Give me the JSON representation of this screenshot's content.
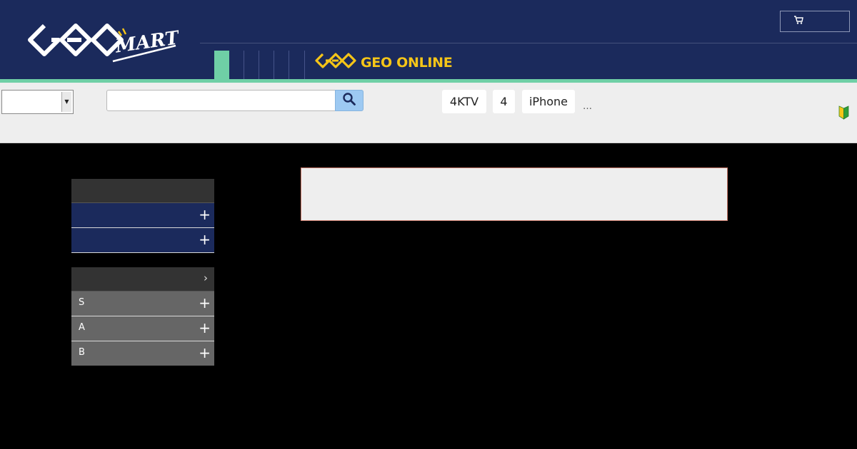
{
  "header": {
    "logo": {
      "text": "GEO MART",
      "icon": "geo-mart-logo"
    },
    "cart": {
      "label": "",
      "icon": "cart-icon"
    },
    "nav_tabs": [
      "",
      "",
      "",
      "",
      "",
      ""
    ],
    "geo_online": {
      "label": "GEO ONLINE",
      "icon": "geo-logo"
    }
  },
  "search": {
    "category_select": {
      "value": ""
    },
    "input": {
      "value": "",
      "placeholder": ""
    },
    "button_icon": "search-icon",
    "keywords": [
      "4KTV",
      "4",
      "iPhone"
    ],
    "more": "…",
    "beginner_icon": "beginner-mark-icon"
  },
  "sidebar": {
    "header": "",
    "rows": [
      {
        "label": "",
        "expand": "+"
      },
      {
        "label": "",
        "expand": "+"
      }
    ]
  },
  "sidebar2": {
    "header": "",
    "header_chevron": "›",
    "rows": [
      {
        "label": "S",
        "expand": "+"
      },
      {
        "label": "A",
        "expand": "+"
      },
      {
        "label": "B",
        "expand": "+"
      }
    ]
  },
  "notice": {
    "text": ""
  },
  "colors": {
    "header_bg": "#1b2a5c",
    "accent_green": "#6fcfa6",
    "geo_online_yellow": "#f5c518",
    "search_band_bg": "#eeeeee",
    "search_button": "#9dc9f2",
    "sidebar_dark": "#333333",
    "sidebar_gray": "#666666"
  }
}
